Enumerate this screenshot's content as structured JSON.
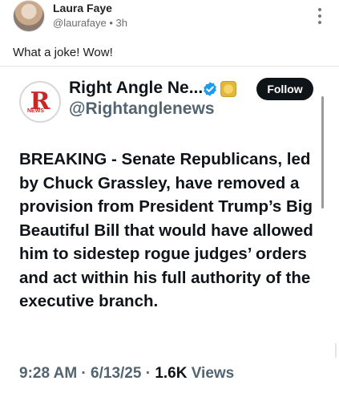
{
  "post": {
    "author_name": "Laura Faye",
    "author_handle": "@laurafaye",
    "separator": "•",
    "time": "3h",
    "text": "What a joke! Wow!"
  },
  "embed": {
    "logo_letter": "R",
    "logo_tag": "NEWS",
    "account_name": "Right Angle Ne...",
    "account_handle": "@Rightanglenews",
    "follow_label": "Follow",
    "body": "BREAKING - Senate Republicans, led by Chuck Grassley, have removed a provision from President Trump’s Big Beautiful Bill that would have allowed him to sidestep rogue judges’ orders and act within his full authority of the executive branch.",
    "timestamp": "9:28 AM · 6/13/25 · ",
    "views_count": "1.6K",
    "views_label": " Views"
  },
  "icons": {
    "more": "more-vertical-icon",
    "verified": "verified-badge-icon",
    "affiliate": "gold-affiliate-icon"
  },
  "colors": {
    "follow_bg": "#0f1419",
    "verified": "#1d9bf0",
    "logo_red": "#c62828",
    "muted": "#536471"
  }
}
